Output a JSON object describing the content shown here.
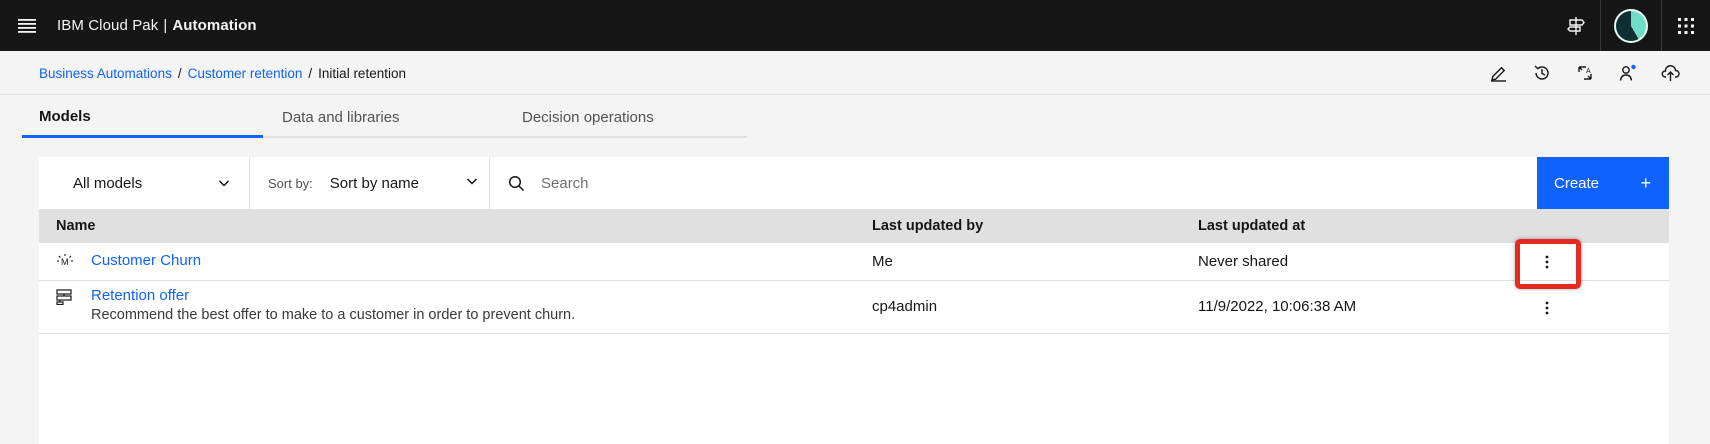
{
  "header": {
    "brand_prefix": "IBM Cloud Pak",
    "brand_sep": "|",
    "brand_product": "Automation",
    "icons": [
      "menu-icon",
      "signpost-icon",
      "avatar",
      "app-switcher-icon"
    ]
  },
  "breadcrumb": {
    "items": [
      "Business Automations",
      "Customer retention"
    ],
    "current": "Initial retention",
    "tools": [
      "edit-icon",
      "history-icon",
      "compare-icon",
      "user-share-icon",
      "cloud-upload-icon"
    ]
  },
  "tabs": [
    {
      "label": "Models",
      "active": true
    },
    {
      "label": "Data and libraries",
      "active": false
    },
    {
      "label": "Decision operations",
      "active": false
    }
  ],
  "toolbar": {
    "filter_value": "All models",
    "sort_label": "Sort by:",
    "sort_value": "Sort by name",
    "search_placeholder": "Search",
    "create_label": "Create",
    "create_icon": "+"
  },
  "table": {
    "columns": [
      "Name",
      "Last updated by",
      "Last updated at"
    ],
    "rows": [
      {
        "icon": "machine-learning-model-icon",
        "name": "Customer Churn",
        "description": "",
        "updated_by": "Me",
        "updated_at": "Never shared",
        "highlighted": true
      },
      {
        "icon": "decision-tree-icon",
        "name": "Retention offer",
        "description": "Recommend the best offer to make to a customer in order to prevent churn.",
        "updated_by": "cp4admin",
        "updated_at": "11/9/2022, 10:06:38 AM",
        "highlighted": false
      }
    ]
  },
  "colors": {
    "header_bg": "#161616",
    "accent": "#0f62fe",
    "highlight": "#e52b20",
    "page_bg": "#f4f4f4"
  }
}
